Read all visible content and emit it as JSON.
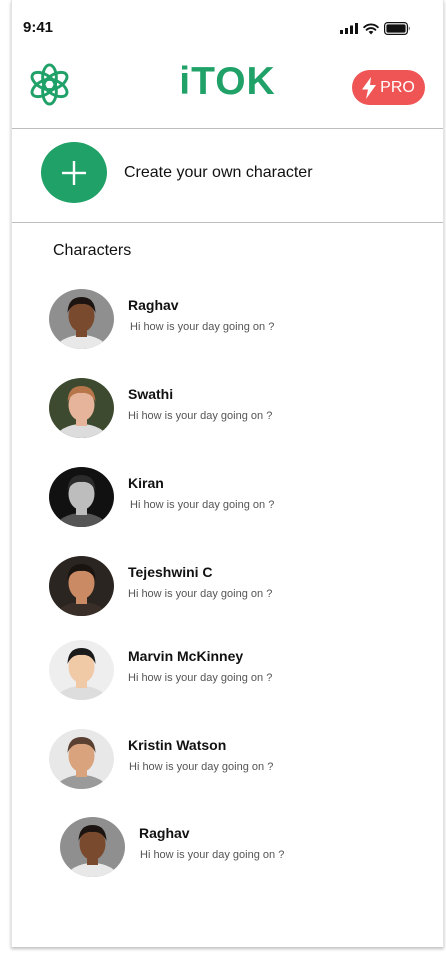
{
  "status_bar": {
    "time": "9:41"
  },
  "header": {
    "title": "iTOK",
    "pro_label": "PRO",
    "logo_icon": "openai-knot-icon",
    "accent_color": "#1fa168",
    "pro_color": "#ef5555"
  },
  "create": {
    "label": "Create your own character"
  },
  "characters_section": {
    "title": "Characters",
    "items": [
      {
        "name": "Raghav",
        "message": "Hi how is your day going on ?",
        "avatar_bg": "#8f8f8f",
        "skin": "#7a4a2e",
        "hair": "#1c1410",
        "shirt": "#e8e8e8"
      },
      {
        "name": "Swathi",
        "message": "Hi how is your day going on ?",
        "avatar_bg": "#3d4a2f",
        "skin": "#e6b49a",
        "hair": "#b7764a",
        "shirt": "#dcdcdc"
      },
      {
        "name": "Kiran",
        "message": "Hi how is your day going on ?",
        "avatar_bg": "#111111",
        "skin": "#bdbdbd",
        "hair": "#2b2b2b",
        "shirt": "#555555"
      },
      {
        "name": "Tejeshwini C",
        "message": "Hi how is your day going on ?",
        "avatar_bg": "#2a2520",
        "skin": "#c98a64",
        "hair": "#1a1410",
        "shirt": "#3a2f28"
      },
      {
        "name": "Marvin McKinney",
        "message": "Hi how is your day going on ?",
        "avatar_bg": "#eeeeee",
        "skin": "#f0c9a6",
        "hair": "#1a1a1a",
        "shirt": "#dddddd"
      },
      {
        "name": "Kristin Watson",
        "message": "Hi how is your day going on ?",
        "avatar_bg": "#e8e8e8",
        "skin": "#d9a37e",
        "hair": "#5a4030",
        "shirt": "#9a9a9a"
      },
      {
        "name": "Raghav",
        "message": "Hi how is your day going on ?",
        "avatar_bg": "#8f8f8f",
        "skin": "#7a4a2e",
        "hair": "#1c1410",
        "shirt": "#e8e8e8"
      }
    ]
  }
}
